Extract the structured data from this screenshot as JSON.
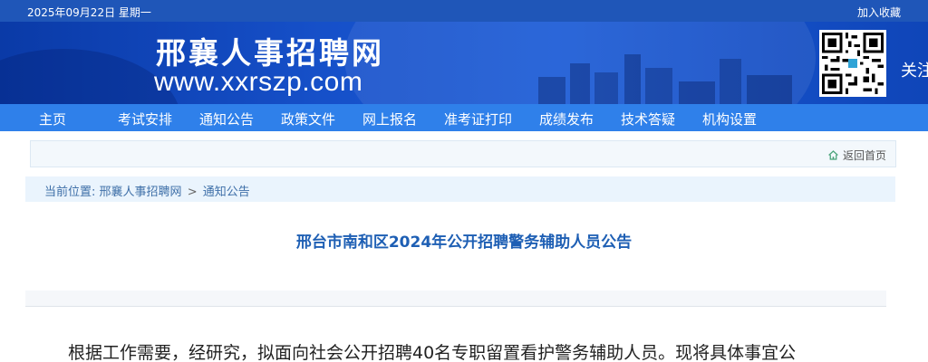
{
  "topbar": {
    "date": "2025年09月22日 星期一",
    "favorite": "加入收藏"
  },
  "banner": {
    "site_name": "邢襄人事招聘网",
    "url": "www.xxrszp.com",
    "follow": "关注",
    "qr_icon": "qr-code-icon"
  },
  "nav": {
    "items": [
      "主页",
      "考试安排",
      "通知公告",
      "政策文件",
      "网上报名",
      "准考证打印",
      "成绩发布",
      "技术答疑",
      "机构设置"
    ]
  },
  "back": {
    "label": "返回首页",
    "icon": "home-icon"
  },
  "breadcrumb": {
    "prefix": "当前位置:",
    "site": "邢襄人事招聘网",
    "separator": ">",
    "section": "通知公告"
  },
  "article": {
    "title": "邢台市南和区2024年公开招聘警务辅助人员公告",
    "first_line": "根据工作需要，经研究，拟面向社会公开招聘40名专职留置看护警务辅助人员。现将具体事宜公"
  },
  "colors": {
    "topbar": "#1f56b8",
    "nav": "#2f80ea",
    "title": "#1e5fb4"
  }
}
